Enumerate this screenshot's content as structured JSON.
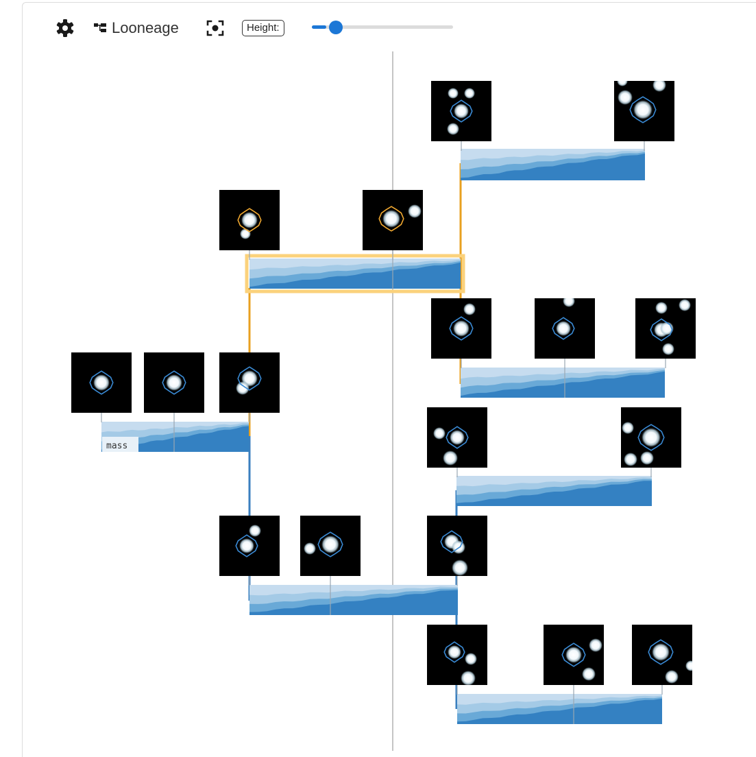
{
  "toolbar": {
    "settings_icon": "gear-icon",
    "app_icon": "lineage-tree-icon",
    "app_name": "Looneage",
    "recenter_icon": "recenter-icon",
    "height_label": "Height:",
    "height_slider_value": 0.1
  },
  "tree": {
    "track_label": "mass",
    "colors": {
      "selected_branch": "#e8a020",
      "selected_highlight": "#fbd27c",
      "branch": "#3a7fbf",
      "track_light": "#c6dcef",
      "track_mid": "#9dc7e4",
      "track_dark": "#5fa3d4",
      "track_darkest": "#2f7cc0",
      "cell_outline": "#3a8ad4",
      "selected_outline": "#f0a830"
    }
  }
}
